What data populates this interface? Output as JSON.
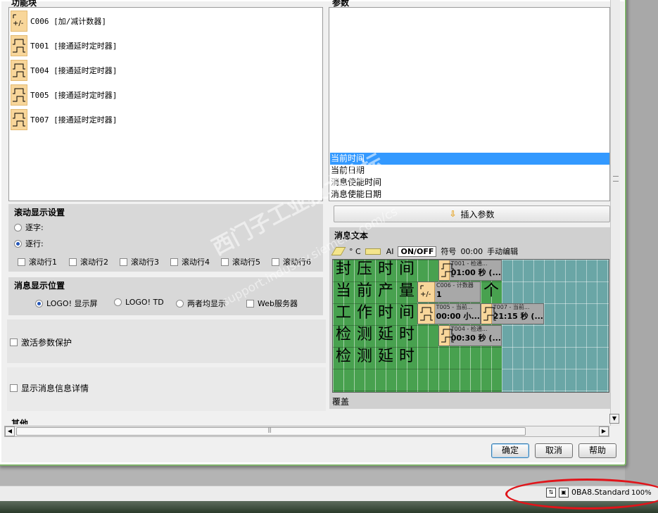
{
  "headers": {
    "left": "功能块",
    "right": "参数"
  },
  "blocks": [
    {
      "label": "C006 [加/减计数器]",
      "icon": "counter-icon"
    },
    {
      "label": "T001 [接通延时定时器]",
      "icon": "timer-icon"
    },
    {
      "label": "T004 [接通延时定时器]",
      "icon": "timer-icon"
    },
    {
      "label": "T005 [接通延时定时器]",
      "icon": "timer-icon"
    },
    {
      "label": "T007 [接通延时定时器]",
      "icon": "timer-icon"
    }
  ],
  "params": [
    {
      "label": "当前时间",
      "selected": true
    },
    {
      "label": "当前日期",
      "selected": false
    },
    {
      "label": "消息使能时间",
      "selected": false
    },
    {
      "label": "消息使能日期",
      "selected": false
    }
  ],
  "scroll_settings": {
    "title": "滚动显示设置",
    "by_char": "逐字:",
    "by_line": "逐行:",
    "lines": [
      "滚动行1",
      "滚动行2",
      "滚动行3",
      "滚动行4",
      "滚动行5",
      "滚动行6"
    ]
  },
  "display_position": {
    "title": "消息显示位置",
    "options": [
      "LOGO! 显示屏",
      "LOGO! TD",
      "两者均显示",
      "Web服务器"
    ]
  },
  "activate_param_protection": "激活参数保护",
  "show_message_details": "显示消息信息详情",
  "other_label": "其他",
  "insert_param_button": "插入参数",
  "message_text": {
    "title": "消息文本",
    "toolbar": {
      "degree": "° C",
      "ai": "AI",
      "onoff": "ON/OFF",
      "symbol": "符号",
      "time": "00:00",
      "manual_edit": "手动编辑"
    },
    "rows": [
      [
        "封",
        "压",
        "时",
        "间"
      ],
      [
        "当",
        "前",
        "产",
        "量"
      ],
      [
        "工",
        "作",
        "时",
        "间"
      ],
      [
        "检",
        "测",
        "延",
        "时"
      ],
      [
        "检",
        "测",
        "延",
        "时"
      ]
    ],
    "extra_char": "个",
    "params": [
      {
        "name": "T001 - 检通...",
        "value": "01:00 秒 (...",
        "icon": "timer-icon"
      },
      {
        "name": "C006 - 计数器",
        "value": "1",
        "icon": "counter-icon"
      },
      {
        "name": "T005 - 当前...",
        "value": "00:00 小...",
        "icon": "timer-icon"
      },
      {
        "name": "T007 - 当前...",
        "value": "21:15 秒 (...",
        "icon": "timer-icon"
      },
      {
        "name": "T004 - 检通...",
        "value": "00:30 秒 (...",
        "icon": "timer-icon"
      }
    ],
    "overlay": "覆盖"
  },
  "buttons": {
    "ok": "确定",
    "cancel": "取消",
    "help": "帮助"
  },
  "status": {
    "version": "0BA8.Standard",
    "zoom": "100%"
  },
  "watermark": {
    "main": "西门子工业技术论坛",
    "sub": "support.industry.siemens.com/cs"
  },
  "colors": {
    "accent": "#3399ff",
    "grid_green": "#48a14f",
    "grid_teal": "#6aa6a6",
    "annotation": "#e0141a"
  }
}
